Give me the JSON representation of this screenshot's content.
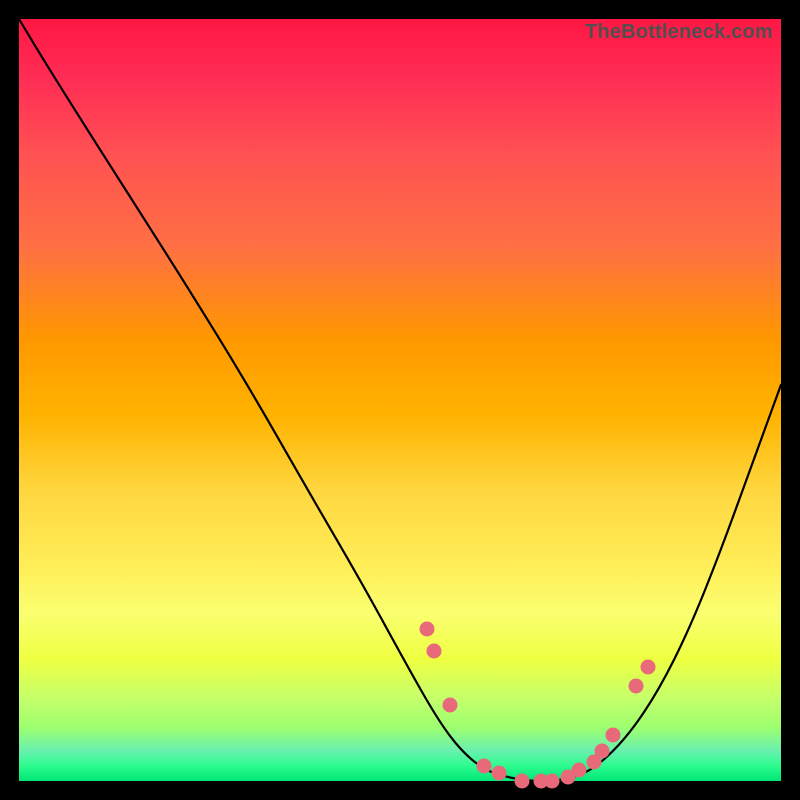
{
  "watermark": "TheBottleneck.com",
  "colors": {
    "dot": "#e86a7a",
    "curve": "#000000",
    "frame": "#000000"
  },
  "chart_data": {
    "type": "line",
    "title": "",
    "xlabel": "",
    "ylabel": "",
    "xlim": [
      0,
      100
    ],
    "ylim": [
      0,
      100
    ],
    "grid": false,
    "legend": false,
    "series": [
      {
        "name": "curve",
        "x": [
          0,
          3,
          8,
          15,
          22,
          30,
          38,
          45,
          51,
          55,
          58,
          61,
          64,
          67,
          70,
          73,
          76,
          80,
          84,
          88,
          92,
          96,
          100
        ],
        "y": [
          100,
          95,
          87,
          76,
          65,
          52,
          38,
          26,
          15,
          8,
          4,
          1.5,
          0.5,
          0,
          0,
          0.5,
          2,
          6,
          12,
          20,
          30,
          41,
          52
        ]
      }
    ],
    "dots": [
      {
        "x": 53.5,
        "y": 20
      },
      {
        "x": 54.5,
        "y": 17
      },
      {
        "x": 56.5,
        "y": 10
      },
      {
        "x": 61,
        "y": 2
      },
      {
        "x": 63,
        "y": 1
      },
      {
        "x": 66,
        "y": 0
      },
      {
        "x": 68.5,
        "y": 0
      },
      {
        "x": 70,
        "y": 0
      },
      {
        "x": 72,
        "y": 0.5
      },
      {
        "x": 73.5,
        "y": 1.5
      },
      {
        "x": 75.5,
        "y": 2.5
      },
      {
        "x": 76.5,
        "y": 4
      },
      {
        "x": 78,
        "y": 6
      },
      {
        "x": 81,
        "y": 12.5
      },
      {
        "x": 82.5,
        "y": 15
      }
    ]
  }
}
